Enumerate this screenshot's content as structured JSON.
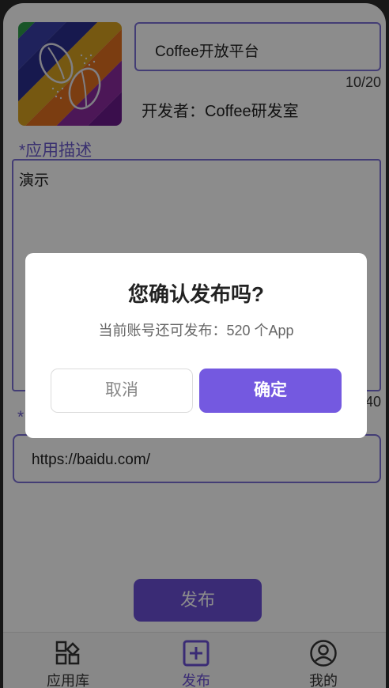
{
  "form": {
    "app_name": "Coffee开放平台",
    "name_count": "10/20",
    "developer": "开发者：Coffee研发室",
    "desc_label": "*应用描述",
    "desc_value": "演示",
    "desc_count": "40",
    "url_label": "*",
    "url_value": "https://baidu.com/",
    "publish_label": "发布"
  },
  "tabs": [
    {
      "label": "应用库",
      "icon": "grid-icon"
    },
    {
      "label": "发布",
      "icon": "plus-square-icon"
    },
    {
      "label": "我的",
      "icon": "user-icon"
    }
  ],
  "dialog": {
    "title": "您确认发布吗?",
    "message": "当前账号还可发布：520 个App",
    "cancel_label": "取消",
    "confirm_label": "确定"
  },
  "colors": {
    "accent": "#7459e0",
    "border": "#7b6fd6"
  }
}
